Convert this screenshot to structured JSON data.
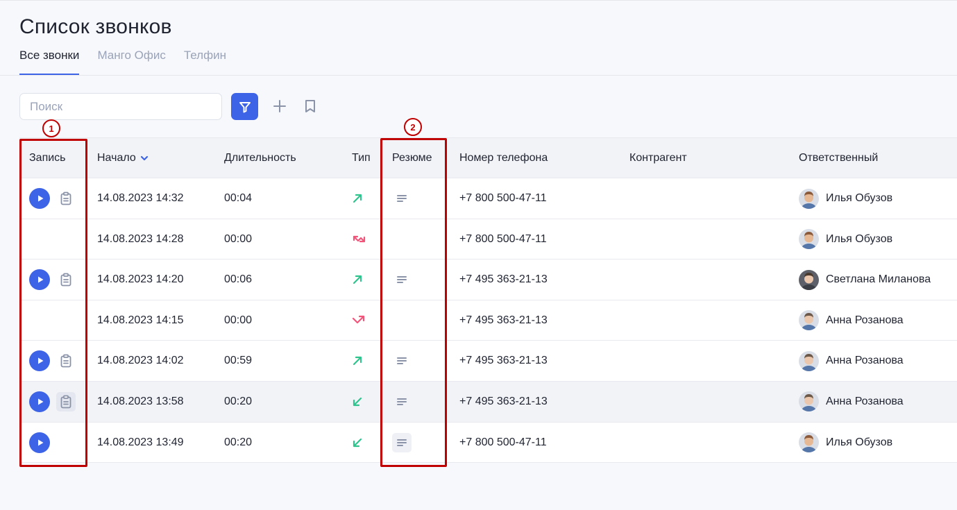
{
  "page": {
    "title": "Список звонков"
  },
  "tabs": [
    {
      "label": "Все звонки",
      "active": true
    },
    {
      "label": "Манго Офис",
      "active": false
    },
    {
      "label": "Телфин",
      "active": false
    }
  ],
  "toolbar": {
    "search_placeholder": "Поиск",
    "accent_color": "#3d63e6"
  },
  "table": {
    "columns": {
      "record": "Запись",
      "start": "Начало",
      "duration": "Длительность",
      "type": "Тип",
      "summary": "Резюме",
      "phone": "Номер телефона",
      "counterparty": "Контрагент",
      "responsible": "Ответственный"
    },
    "rows": [
      {
        "has_record": true,
        "has_transcript": true,
        "start": "14.08.2023 14:32",
        "duration": "00:04",
        "type": "outgoing",
        "has_summary": true,
        "phone": "+7 800 500-47-11",
        "counterparty": "",
        "responsible": "Илья Обузов"
      },
      {
        "has_record": false,
        "has_transcript": false,
        "start": "14.08.2023 14:28",
        "duration": "00:00",
        "type": "missed-incoming",
        "has_summary": false,
        "phone": "+7 800 500-47-11",
        "counterparty": "",
        "responsible": "Илья Обузов"
      },
      {
        "has_record": true,
        "has_transcript": true,
        "start": "14.08.2023 14:20",
        "duration": "00:06",
        "type": "outgoing",
        "has_summary": true,
        "phone": "+7 495 363-21-13",
        "counterparty": "",
        "responsible": "Светлана Миланова"
      },
      {
        "has_record": false,
        "has_transcript": false,
        "start": "14.08.2023 14:15",
        "duration": "00:00",
        "type": "missed-outgoing",
        "has_summary": false,
        "phone": "+7 495 363-21-13",
        "counterparty": "",
        "responsible": "Анна Розанова"
      },
      {
        "has_record": true,
        "has_transcript": true,
        "start": "14.08.2023 14:02",
        "duration": "00:59",
        "type": "outgoing",
        "has_summary": true,
        "phone": "+7 495 363-21-13",
        "counterparty": "",
        "responsible": "Анна Розанова"
      },
      {
        "has_record": true,
        "has_transcript": true,
        "start": "14.08.2023 13:58",
        "duration": "00:20",
        "type": "incoming",
        "has_summary": true,
        "phone": "+7 495 363-21-13",
        "counterparty": "",
        "responsible": "Анна Розанова"
      },
      {
        "has_record": true,
        "has_transcript": false,
        "start": "14.08.2023 13:49",
        "duration": "00:20",
        "type": "incoming",
        "has_summary": true,
        "phone": "+7 800 500-47-11",
        "counterparty": "",
        "responsible": "Илья Обузов"
      }
    ]
  },
  "annotations": [
    {
      "label": "1"
    },
    {
      "label": "2"
    }
  ],
  "colors": {
    "outgoing": "#2fc48d",
    "missed": "#f2557a",
    "annotation": "#c00000"
  }
}
